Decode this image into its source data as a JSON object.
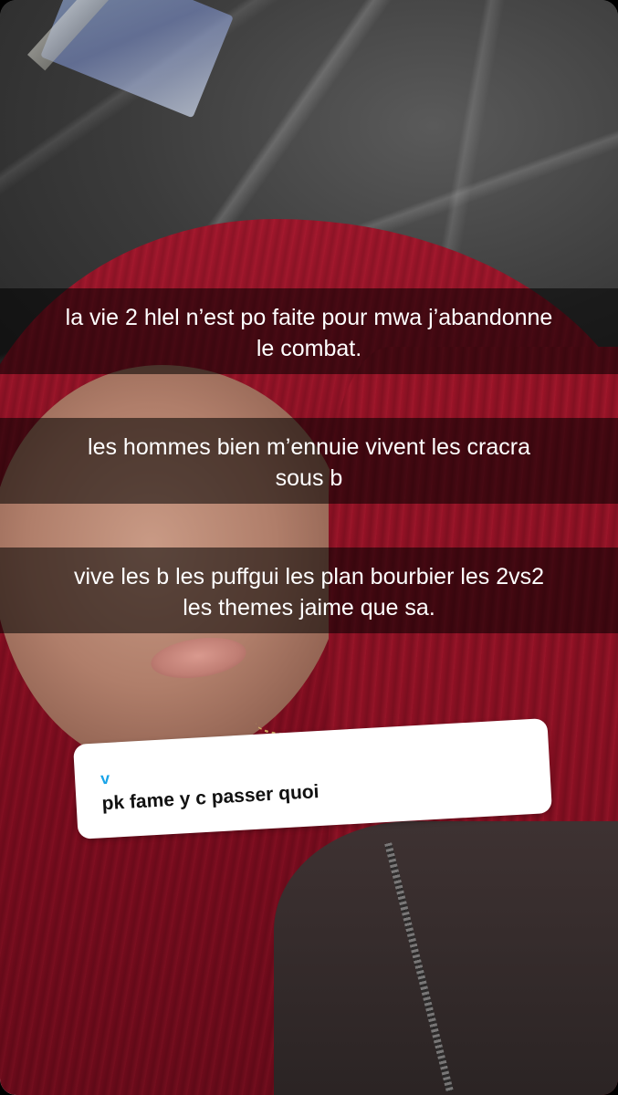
{
  "story": {
    "captions": [
      {
        "line1": "la vie 2 hlel n’est po faite pour mwa j’abandonne",
        "line2": "le combat."
      },
      {
        "line1": "les hommes bien m’ennuie vivent les cracra",
        "line2": "sous b"
      },
      {
        "line1": "vive les b les puffgui les plan bourbier les 2vs2",
        "line2": "les themes jaime que sa."
      }
    ],
    "question_sticker": {
      "sender": "v",
      "text": "pk fame y c passer quoi"
    }
  },
  "colors": {
    "caption_bg": "rgba(0,0,0,0.55)",
    "caption_text": "#ffffff",
    "sticker_bg": "#ffffff",
    "sticker_sender": "#19a4e8",
    "sticker_text": "#111111",
    "hair": "#8a0f22"
  }
}
